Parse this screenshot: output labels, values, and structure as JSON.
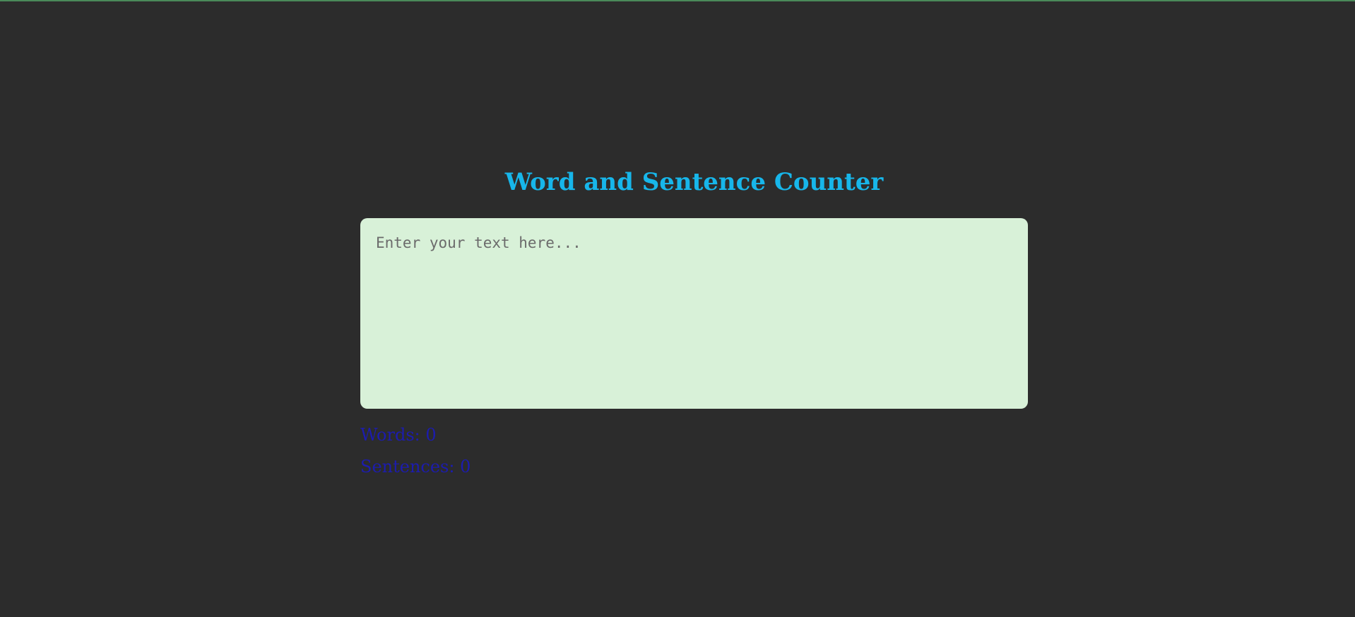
{
  "app": {
    "title": "Word and Sentence Counter"
  },
  "input": {
    "placeholder": "Enter your text here...",
    "value": ""
  },
  "stats": {
    "words_label": "Words: ",
    "words_count": "0",
    "sentences_label": "Sentences: ",
    "sentences_count": "0"
  },
  "colors": {
    "background": "#2c2c2c",
    "title": "#17b6ea",
    "textarea_bg": "#d8f1d8",
    "stats_text": "#1c1cae"
  }
}
